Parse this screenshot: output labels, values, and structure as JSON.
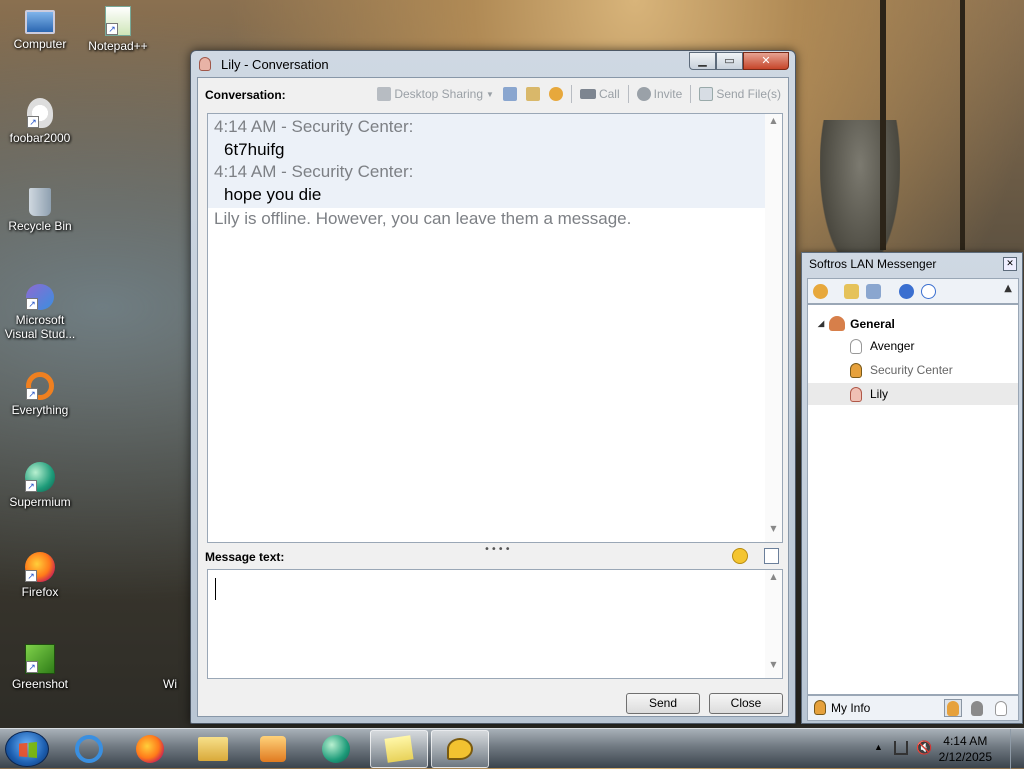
{
  "desktop": {
    "icons": [
      {
        "label": "Computer",
        "icon": "computer-icon"
      },
      {
        "label": "Notepad++",
        "icon": "notepadpp-icon"
      },
      {
        "label": "foobar2000",
        "icon": "foobar-icon"
      },
      {
        "label": "Recycle Bin",
        "icon": "recycle-bin-icon"
      },
      {
        "label": "Microsoft Visual Stud...",
        "icon": "visual-studio-icon"
      },
      {
        "label": "Everything",
        "icon": "everything-icon"
      },
      {
        "label": "Supermium",
        "icon": "supermium-icon"
      },
      {
        "label": "Firefox",
        "icon": "firefox-icon"
      },
      {
        "label": "Greenshot",
        "icon": "greenshot-icon"
      },
      {
        "label": "Wi",
        "icon": "partial-icon"
      }
    ]
  },
  "conversation": {
    "title": "Lily - Conversation",
    "section_label": "Conversation:",
    "toolbar": {
      "desktop_sharing": "Desktop Sharing",
      "call": "Call",
      "invite": "Invite",
      "send_files": "Send File(s)"
    },
    "messages": [
      {
        "header": "4:14 AM - Security Center:",
        "body": "6t7huifg"
      },
      {
        "header": "4:14 AM - Security Center:",
        "body": "hope you die"
      }
    ],
    "system_note": "Lily is offline. However, you can leave them a message.",
    "splitter_grip": "••••",
    "message_text_label": "Message text:",
    "input_value": "",
    "buttons": {
      "send": "Send",
      "close": "Close"
    }
  },
  "messenger": {
    "title": "Softros LAN Messenger",
    "group": "General",
    "users": [
      {
        "name": "Avenger",
        "status": "offline"
      },
      {
        "name": "Security Center",
        "status": "online"
      },
      {
        "name": "Lily",
        "status": "offline",
        "selected": true
      }
    ],
    "my_info": "My Info"
  },
  "taskbar": {
    "time": "4:14 AM",
    "date": "2/12/2025"
  },
  "colors": {
    "accent": "#1d5fb0",
    "history_highlight": "#ecf1f8",
    "meta_text": "#7d8085"
  }
}
